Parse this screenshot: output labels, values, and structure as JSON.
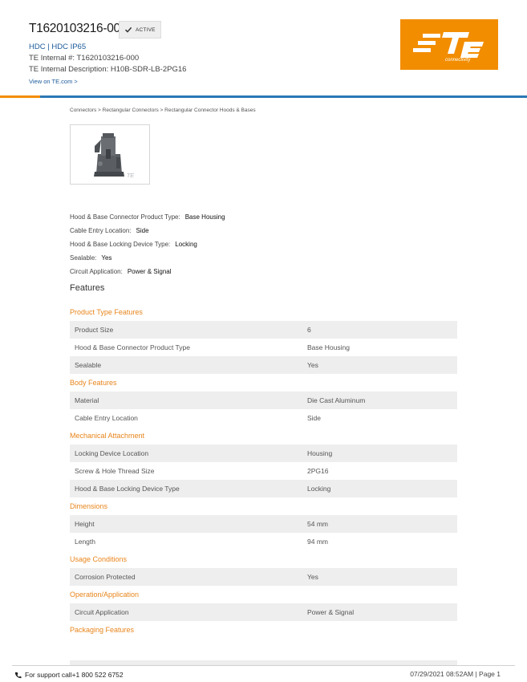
{
  "header": {
    "part_number": "T1620103216-000",
    "status": "ACTIVE",
    "series": [
      "HDC",
      "HDC IP65"
    ],
    "series_separator": " | ",
    "internal_number": "TE Internal #: T1620103216-000",
    "internal_description": "TE Internal Description: H10B-SDR-LB-2PG16",
    "view_link": "View on TE.com >"
  },
  "logo": {
    "mark": "TE",
    "tagline": "connectivity",
    "color": "#f28d00"
  },
  "breadcrumb": "Connectors > Rectangular Connectors > Rectangular Connector Hoods & Bases",
  "attributes": [
    {
      "label": "Hood & Base Connector Product Type:",
      "value": "Base Housing"
    },
    {
      "label": "Cable Entry Location:",
      "value": "Side"
    },
    {
      "label": "Hood & Base Locking Device Type:",
      "value": "Locking"
    },
    {
      "label": "Sealable:",
      "value": "Yes"
    },
    {
      "label": "Circuit Application:",
      "value": "Power & Signal"
    }
  ],
  "features_title": "Features",
  "feature_groups": [
    {
      "title": "Product Type Features",
      "rows": [
        {
          "name": "Product Size",
          "value": "6"
        },
        {
          "name": "Hood & Base Connector Product Type",
          "value": "Base Housing"
        },
        {
          "name": "Sealable",
          "value": "Yes"
        }
      ]
    },
    {
      "title": "Body Features",
      "rows": [
        {
          "name": "Material",
          "value": "Die Cast Aluminum"
        },
        {
          "name": "Cable Entry Location",
          "value": "Side"
        }
      ]
    },
    {
      "title": "Mechanical Attachment",
      "rows": [
        {
          "name": "Locking Device Location",
          "value": "Housing"
        },
        {
          "name": "Screw & Hole Thread Size",
          "value": "2PG16"
        },
        {
          "name": "Hood & Base Locking Device Type",
          "value": "Locking"
        }
      ]
    },
    {
      "title": "Dimensions",
      "rows": [
        {
          "name": "Height",
          "value": "54 mm"
        },
        {
          "name": "Length",
          "value": "94 mm"
        }
      ]
    },
    {
      "title": "Usage Conditions",
      "rows": [
        {
          "name": "Corrosion Protected",
          "value": "Yes"
        }
      ]
    },
    {
      "title": "Operation/Application",
      "rows": [
        {
          "name": "Circuit Application",
          "value": "Power & Signal"
        }
      ]
    },
    {
      "title": "Packaging Features",
      "rows": []
    }
  ],
  "footer": {
    "support": "For support call+1 800 522 6752",
    "timestamp": "07/29/2021 08:52AM | Page 1"
  },
  "colors": {
    "accent_orange": "#e8851b",
    "link_blue": "#1a5a9a",
    "rule_blue": "#2a79b5",
    "row_shade": "#eeeeee"
  }
}
